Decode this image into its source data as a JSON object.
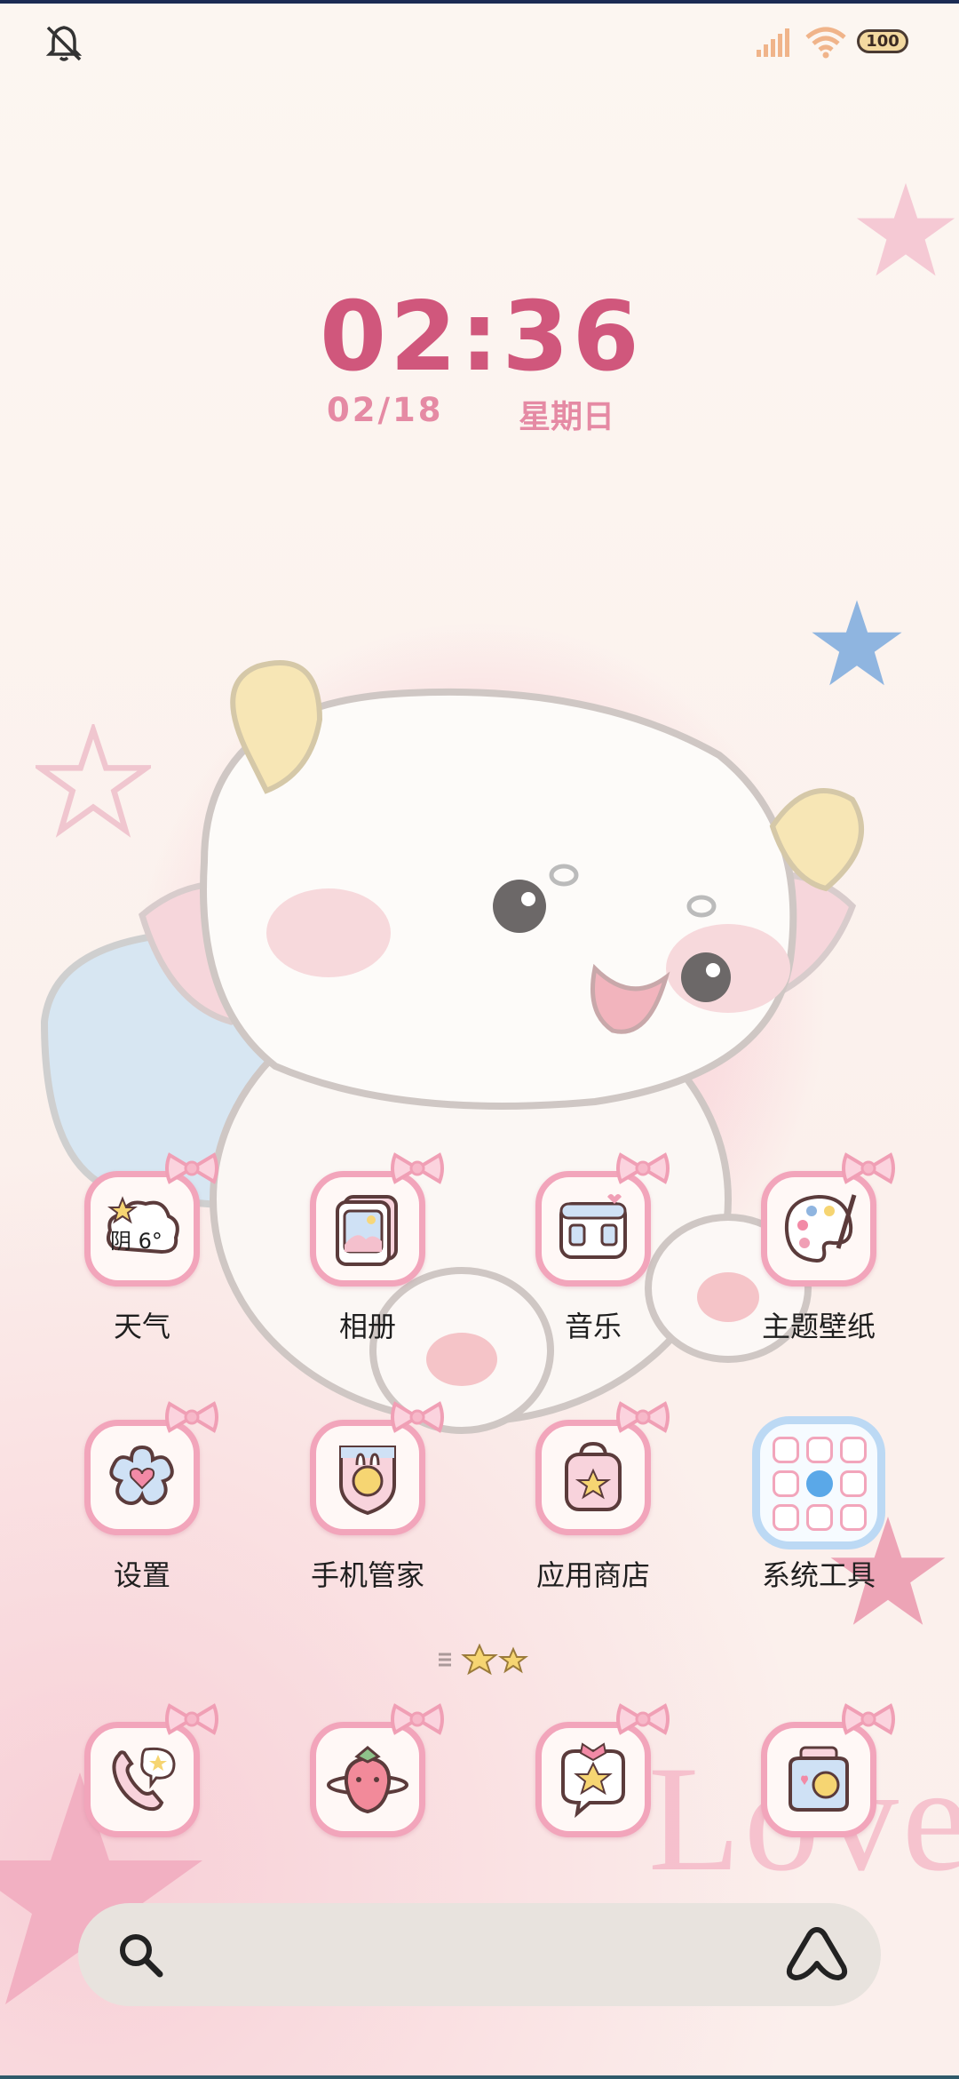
{
  "status_bar": {
    "battery_level": "100",
    "icons": [
      "mute-icon",
      "signal-icon",
      "wifi-icon",
      "battery-icon"
    ]
  },
  "clock": {
    "time": "02:36",
    "date": "02/18",
    "weekday": "星期日"
  },
  "weather_widget": {
    "text": "阴 6°"
  },
  "apps": [
    {
      "label": "天气",
      "icon": "weather-icon"
    },
    {
      "label": "相册",
      "icon": "gallery-icon"
    },
    {
      "label": "音乐",
      "icon": "music-icon"
    },
    {
      "label": "主题壁纸",
      "icon": "theme-palette-icon"
    },
    {
      "label": "设置",
      "icon": "settings-flower-icon"
    },
    {
      "label": "手机管家",
      "icon": "phone-manager-shield-icon"
    },
    {
      "label": "应用商店",
      "icon": "app-store-bag-icon"
    },
    {
      "label": "系统工具",
      "icon": "folder-icon"
    }
  ],
  "dock": [
    {
      "icon": "phone-icon"
    },
    {
      "icon": "browser-strawberry-icon"
    },
    {
      "icon": "messages-icon"
    },
    {
      "icon": "camera-icon"
    }
  ],
  "wallpaper_text": "Love",
  "colors": {
    "accent_pink": "#d0577c",
    "tile_border": "#f2a5bb",
    "folder_border": "#bcd9f4",
    "search_bg": "#e8e3de"
  }
}
